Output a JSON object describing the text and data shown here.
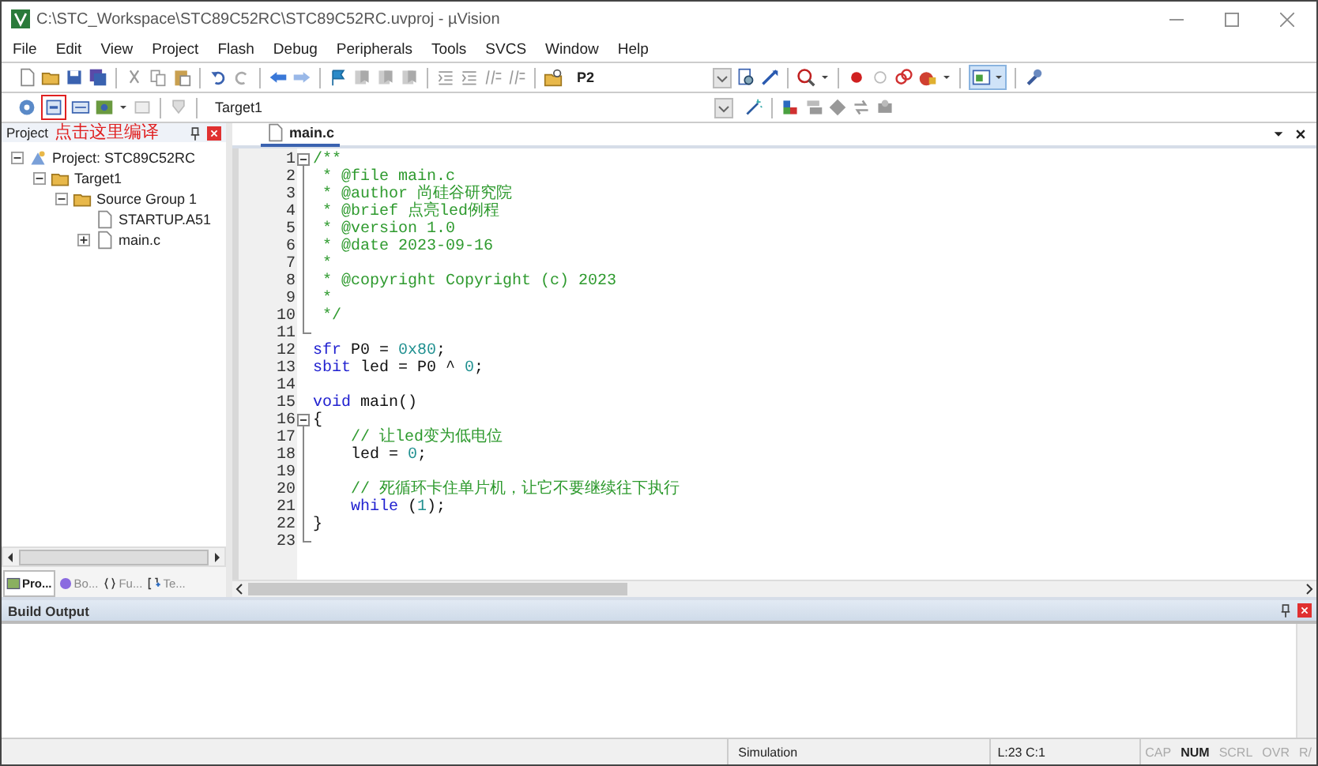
{
  "window": {
    "title": "C:\\STC_Workspace\\STC89C52RC\\STC89C52RC.uvproj - µVision"
  },
  "menu": [
    "File",
    "Edit",
    "View",
    "Project",
    "Flash",
    "Debug",
    "Peripherals",
    "Tools",
    "SVCS",
    "Window",
    "Help"
  ],
  "toolbar": {
    "find_value": "P2",
    "target": "Target1"
  },
  "annotation": {
    "text": "点击这里编译"
  },
  "project_panel": {
    "title": "Project",
    "tree": [
      {
        "label": "Project: STC89C52RC",
        "kind": "project",
        "expanded": true,
        "children": [
          {
            "label": "Target1",
            "kind": "target",
            "expanded": true,
            "children": [
              {
                "label": "Source Group 1",
                "kind": "group",
                "expanded": true,
                "children": [
                  {
                    "label": "STARTUP.A51",
                    "kind": "file"
                  },
                  {
                    "label": "main.c",
                    "kind": "file",
                    "expanded": false
                  }
                ]
              }
            ]
          }
        ]
      }
    ]
  },
  "panel_tabs": [
    {
      "label": "Pro...",
      "kind": "project",
      "selected": true
    },
    {
      "label": "Bo...",
      "kind": "books",
      "selected": false
    },
    {
      "label": "Fu...",
      "kind": "functions",
      "selected": false
    },
    {
      "label": "Te...",
      "kind": "templates",
      "selected": false
    }
  ],
  "editor": {
    "tabs": [
      {
        "label": "main.c",
        "selected": true
      }
    ],
    "lines": [
      {
        "number": "1",
        "fold_start": true,
        "fold_end": false,
        "segments": [
          {
            "text": "/**",
            "kind": "comment"
          }
        ]
      },
      {
        "number": "2",
        "fold_start": false,
        "fold_end": false,
        "segments": [
          {
            "text": " * @file main.c",
            "kind": "comment"
          }
        ]
      },
      {
        "number": "3",
        "fold_start": false,
        "fold_end": false,
        "segments": [
          {
            "text": " * @author 尚硅谷研究院",
            "kind": "comment"
          }
        ]
      },
      {
        "number": "4",
        "fold_start": false,
        "fold_end": false,
        "segments": [
          {
            "text": " * @brief 点亮led例程",
            "kind": "comment"
          }
        ]
      },
      {
        "number": "5",
        "fold_start": false,
        "fold_end": false,
        "segments": [
          {
            "text": " * @version 1.0",
            "kind": "comment"
          }
        ]
      },
      {
        "number": "6",
        "fold_start": false,
        "fold_end": false,
        "segments": [
          {
            "text": " * @date 2023-09-16",
            "kind": "comment"
          }
        ]
      },
      {
        "number": "7",
        "fold_start": false,
        "fold_end": false,
        "segments": [
          {
            "text": " *",
            "kind": "comment"
          }
        ]
      },
      {
        "number": "8",
        "fold_start": false,
        "fold_end": false,
        "segments": [
          {
            "text": " * @copyright Copyright (c) 2023",
            "kind": "comment"
          }
        ]
      },
      {
        "number": "9",
        "fold_start": false,
        "fold_end": false,
        "segments": [
          {
            "text": " *",
            "kind": "comment"
          }
        ]
      },
      {
        "number": "10",
        "fold_start": false,
        "fold_end": false,
        "segments": [
          {
            "text": " */",
            "kind": "comment"
          }
        ]
      },
      {
        "number": "11",
        "fold_start": false,
        "fold_end": true
      },
      {
        "number": "12",
        "fold_start": false,
        "fold_end": false,
        "segments": [
          {
            "text": "sfr",
            "kind": "keyword"
          },
          {
            "text": " P0 = ",
            "kind": "plain"
          },
          {
            "text": "0x80",
            "kind": "number"
          },
          {
            "text": ";",
            "kind": "plain"
          }
        ]
      },
      {
        "number": "13",
        "fold_start": false,
        "fold_end": false,
        "segments": [
          {
            "text": "sbit",
            "kind": "keyword"
          },
          {
            "text": " led = P0 ^ ",
            "kind": "plain"
          },
          {
            "text": "0",
            "kind": "number"
          },
          {
            "text": ";",
            "kind": "plain"
          }
        ]
      },
      {
        "number": "14",
        "fold_start": false,
        "fold_end": false
      },
      {
        "number": "15",
        "fold_start": false,
        "fold_end": false,
        "segments": [
          {
            "text": "void",
            "kind": "keyword"
          },
          {
            "text": " main()",
            "kind": "plain"
          }
        ]
      },
      {
        "number": "16",
        "fold_start": true,
        "fold_end": false,
        "segments": [
          {
            "text": "{",
            "kind": "plain"
          }
        ]
      },
      {
        "number": "17",
        "fold_start": false,
        "fold_end": false,
        "segments": [
          {
            "text": "    // 让led变为低电位",
            "kind": "comment"
          }
        ]
      },
      {
        "number": "18",
        "fold_start": false,
        "fold_end": false,
        "segments": [
          {
            "text": "    led = ",
            "kind": "plain"
          },
          {
            "text": "0",
            "kind": "number"
          },
          {
            "text": ";",
            "kind": "plain"
          }
        ]
      },
      {
        "number": "19",
        "fold_start": false,
        "fold_end": false
      },
      {
        "number": "20",
        "fold_start": false,
        "fold_end": false,
        "segments": [
          {
            "text": "    // 死循环卡住单片机，让它不要继续往下执行",
            "kind": "comment"
          }
        ]
      },
      {
        "number": "21",
        "fold_start": false,
        "fold_end": false,
        "segments": [
          {
            "text": "    while",
            "kind": "keyword"
          },
          {
            "text": " (",
            "kind": "plain"
          },
          {
            "text": "1",
            "kind": "number"
          },
          {
            "text": ");",
            "kind": "plain"
          }
        ]
      },
      {
        "number": "22",
        "fold_start": false,
        "fold_end": false,
        "segments": [
          {
            "text": "}",
            "kind": "plain"
          }
        ]
      },
      {
        "number": "23",
        "fold_start": false,
        "fold_end": true
      }
    ]
  },
  "build_output": {
    "title": "Build Output"
  },
  "status_bar": {
    "mode": "Simulation",
    "position": "L:23 C:1",
    "indicators": [
      {
        "label": "CAP",
        "on": false
      },
      {
        "label": "NUM",
        "on": true
      },
      {
        "label": "SCRL",
        "on": false
      },
      {
        "label": "OVR",
        "on": false
      },
      {
        "label": "R/",
        "on": false
      }
    ]
  }
}
